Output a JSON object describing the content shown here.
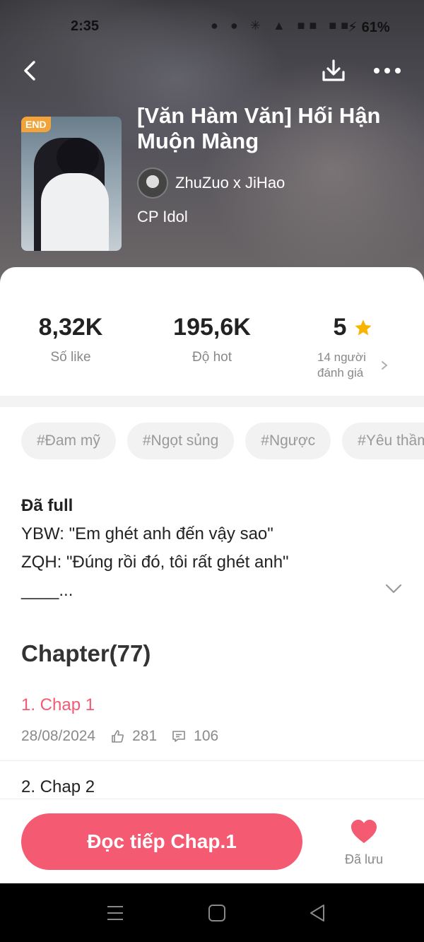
{
  "status_bar": {
    "time": "2:35",
    "icons": "● ● ✳ ▲ ■■ ■■",
    "battery": "⚡ 61%"
  },
  "book": {
    "badge": "END",
    "title": "[Văn Hàm Văn] Hối Hận Muộn Màng",
    "author": "ZhuZuo x JiHao",
    "category": "CP Idol"
  },
  "stats": {
    "likes_value": "8,32K",
    "likes_label": "Số like",
    "hot_value": "195,6K",
    "hot_label": "Độ hot",
    "rating_value": "5",
    "rating_label_line1": "14 người",
    "rating_label_line2": "đánh giá"
  },
  "tags": [
    "#Đam mỹ",
    "#Ngọt sủng",
    "#Ngược",
    "#Yêu thầm"
  ],
  "description": {
    "heading": "Đã full",
    "line1": "YBW: \"Em ghét anh đến vậy sao\"",
    "line2": "ZQH: \"Đúng rồi đó, tôi rất ghét anh\"",
    "line3": "____..."
  },
  "chapters": {
    "heading": "Chapter(77)",
    "items": [
      {
        "title": "1. Chap 1",
        "date": "28/08/2024",
        "likes": "281",
        "comments": "106"
      },
      {
        "title": "2. Chap 2"
      }
    ]
  },
  "bottom": {
    "read_button": "Đọc tiếp Chap.1",
    "saved_label": "Đã lưu"
  },
  "colors": {
    "accent": "#f55a73",
    "star": "#f7b500",
    "badge": "#f2a33a"
  }
}
